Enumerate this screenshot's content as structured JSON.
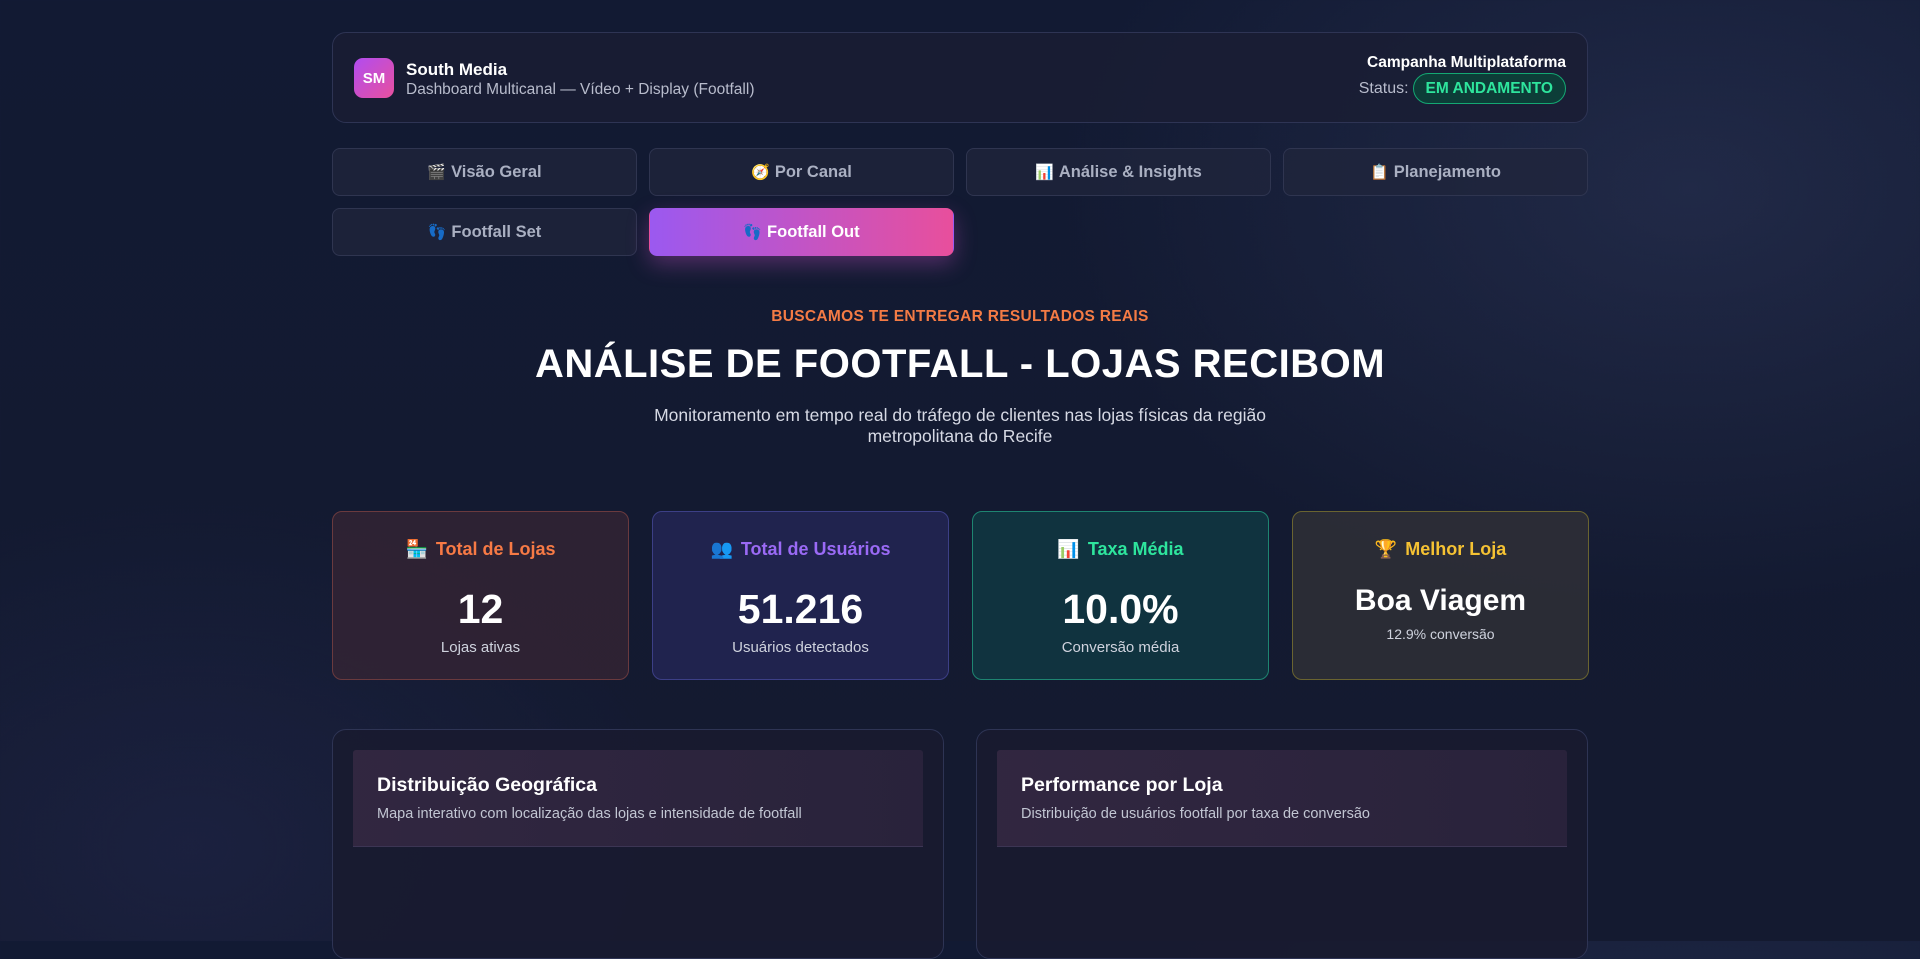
{
  "header": {
    "logo_text": "SM",
    "brand_name": "South Media",
    "brand_subtitle": "Dashboard Multicanal — Vídeo + Display (Footfall)",
    "campaign_title": "Campanha Multiplataforma",
    "status_label": "Status:",
    "status_value": "EM ANDAMENTO"
  },
  "tabs": [
    {
      "icon": "🎬",
      "label": "Visão Geral",
      "active": false
    },
    {
      "icon": "🧭",
      "label": "Por Canal",
      "active": false
    },
    {
      "icon": "📊",
      "label": "Análise & Insights",
      "active": false
    },
    {
      "icon": "📋",
      "label": "Planejamento",
      "active": false
    },
    {
      "icon": "👣",
      "label": "Footfall Set",
      "active": false
    },
    {
      "icon": "👣",
      "label": "Footfall Out",
      "active": true
    }
  ],
  "hero": {
    "eyebrow": "BUSCAMOS TE ENTREGAR RESULTADOS REAIS",
    "title": "ANÁLISE DE FOOTFALL - LOJAS RECIBOM",
    "description": "Monitoramento em tempo real do tráfego de clientes nas lojas físicas da região metropolitana do Recife"
  },
  "stats": {
    "lojas": {
      "icon": "🏪",
      "title": "Total de Lojas",
      "value": "12",
      "sub": "Lojas ativas",
      "color": "#f77a45"
    },
    "users": {
      "icon": "👥",
      "title": "Total de Usuários",
      "value": "51.216",
      "sub": "Usuários detectados",
      "color": "#9a6af5"
    },
    "taxa": {
      "icon": "📊",
      "title": "Taxa Média",
      "value": "10.0%",
      "sub": "Conversão média",
      "color": "#2ee59d"
    },
    "best": {
      "icon": "🏆",
      "title": "Melhor Loja",
      "value": "Boa Viagem",
      "sub": "12.9% conversão",
      "color": "#f5c233"
    }
  },
  "panels": {
    "geo": {
      "title": "Distribuição Geográfica",
      "subtitle": "Mapa interativo com localização das lojas e intensidade de footfall"
    },
    "perf": {
      "title": "Performance por Loja",
      "subtitle": "Distribuição de usuários footfall por taxa de conversão"
    }
  }
}
